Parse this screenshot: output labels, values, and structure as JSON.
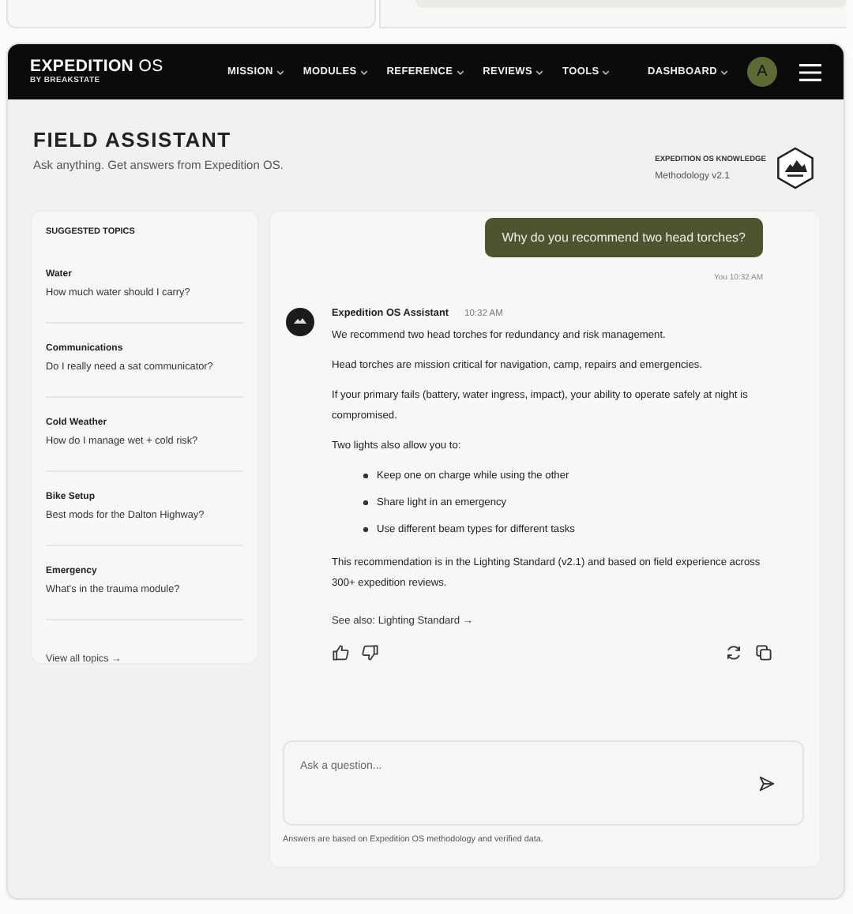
{
  "brand": {
    "name": "**EXPEDITION** OS",
    "tagline": "BY BREAKSTATE"
  },
  "nav": [
    {
      "label": "MISSION"
    },
    {
      "label": "MODULES"
    },
    {
      "label": "REFERENCE"
    },
    {
      "label": "REVIEWS"
    },
    {
      "label": "TOOLS"
    }
  ],
  "dashboard": "DASHBOARD",
  "avatar": "A",
  "page": {
    "title": "FIELD ASSISTANT",
    "subtitle": "Ask anything. Get answers from Expedition OS.",
    "knowledge_label": "EXPEDITION OS KNOWLEDGE",
    "knowledge_version": "Methodology v2.1"
  },
  "topics": {
    "heading": "SUGGESTED TOPICS",
    "items": [
      {
        "title": "Water",
        "question": "How much water should I carry?"
      },
      {
        "title": "Communications",
        "question": "Do I really need a sat communicator?"
      },
      {
        "title": "Cold Weather",
        "question": "How do I manage wet + cold risk?"
      },
      {
        "title": "Bike Setup",
        "question": "Best mods for the Dalton Highway?"
      },
      {
        "title": "Emergency",
        "question": "What's in the trauma module?"
      }
    ],
    "view_all": "View all topics →"
  },
  "messages": [
    {
      "kind": "user",
      "text": "Why do you recommend two head torches?",
      "meta": "You 10:32 AM"
    },
    {
      "kind": "assistant",
      "author": "Expedition OS Assistant",
      "time": "10:32 AM",
      "blocks": [
        {
          "kind": "paragraph",
          "text": "We recommend two head torches for redundancy and risk management."
        },
        {
          "kind": "paragraph",
          "text": "Head torches are mission critical for navigation, camp, repairs and emergencies."
        },
        {
          "kind": "paragraph",
          "text": "If your primary fails (battery, water ingress, impact), your ability to operate safely at night is compromised."
        },
        {
          "kind": "paragraph",
          "text": "Two lights also allow you to:"
        },
        {
          "kind": "list",
          "items": [
            "Keep one on charge while using the other",
            "Share light in an emergency",
            "Use different beam types for different tasks"
          ]
        },
        {
          "kind": "paragraph",
          "text": "This recommendation is in the Lighting Standard (v2.1) and based on field experience across 300+ expedition reviews."
        }
      ],
      "link": "See also: Lighting Standard →"
    }
  ],
  "composer": {
    "placeholder": "Ask a question..."
  },
  "disclaimer": "Answers are based on Expedition OS methodology and verified data."
}
